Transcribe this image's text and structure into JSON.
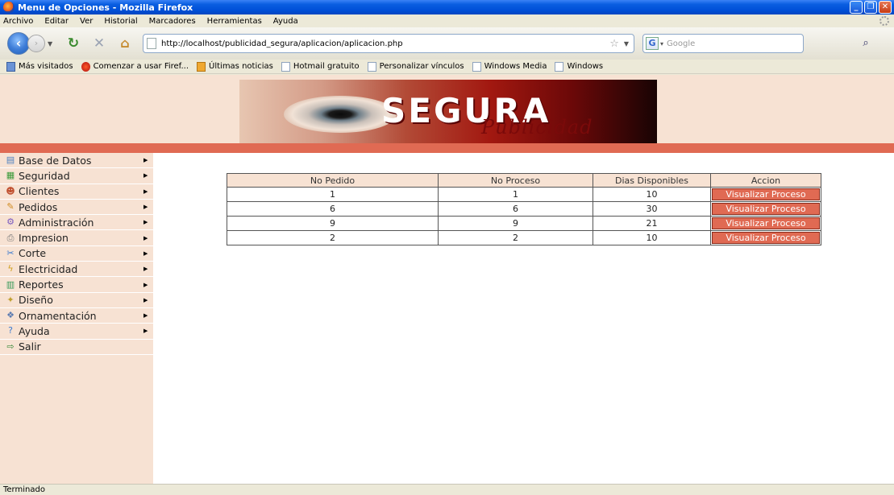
{
  "window": {
    "title": "Menu de Opciones - Mozilla Firefox"
  },
  "menubar": [
    "Archivo",
    "Editar",
    "Ver",
    "Historial",
    "Marcadores",
    "Herramientas",
    "Ayuda"
  ],
  "navigation": {
    "url": "http://localhost/publicidad_segura/aplicacion/aplicacion.php",
    "search_placeholder": "Google"
  },
  "bookmarks": [
    {
      "label": "Más visitados",
      "icon": "visit"
    },
    {
      "label": "Comenzar a usar Firef...",
      "icon": "fox"
    },
    {
      "label": "Últimas noticias",
      "icon": "rss"
    },
    {
      "label": "Hotmail gratuito",
      "icon": "page"
    },
    {
      "label": "Personalizar vínculos",
      "icon": "page"
    },
    {
      "label": "Windows Media",
      "icon": "page"
    },
    {
      "label": "Windows",
      "icon": "page"
    }
  ],
  "banner": {
    "brand": "SEGURA",
    "brand_sub": "Publicidad"
  },
  "sidebar": {
    "items": [
      {
        "label": "Base de Datos",
        "icon": "database-icon",
        "submenu": true
      },
      {
        "label": "Seguridad",
        "icon": "security-icon",
        "submenu": true
      },
      {
        "label": "Clientes",
        "icon": "clients-icon",
        "submenu": true
      },
      {
        "label": "Pedidos",
        "icon": "orders-icon",
        "submenu": true
      },
      {
        "label": "Administración",
        "icon": "admin-icon",
        "submenu": true
      },
      {
        "label": "Impresion",
        "icon": "print-icon",
        "submenu": true
      },
      {
        "label": "Corte",
        "icon": "cut-icon",
        "submenu": true
      },
      {
        "label": "Electricidad",
        "icon": "electricity-icon",
        "submenu": true
      },
      {
        "label": "Reportes",
        "icon": "reports-icon",
        "submenu": true
      },
      {
        "label": "Diseño",
        "icon": "design-icon",
        "submenu": true
      },
      {
        "label": "Ornamentación",
        "icon": "ornament-icon",
        "submenu": true
      },
      {
        "label": "Ayuda",
        "icon": "help-icon",
        "submenu": true
      },
      {
        "label": "Salir",
        "icon": "exit-icon",
        "submenu": false
      }
    ]
  },
  "table": {
    "headers": [
      "No Pedido",
      "No Proceso",
      "Dias Disponibles",
      "Accion"
    ],
    "rows": [
      {
        "pedido": "1",
        "proceso": "1",
        "dias": "10",
        "accion": "Visualizar Proceso"
      },
      {
        "pedido": "6",
        "proceso": "6",
        "dias": "30",
        "accion": "Visualizar Proceso"
      },
      {
        "pedido": "9",
        "proceso": "9",
        "dias": "21",
        "accion": "Visualizar Proceso"
      },
      {
        "pedido": "2",
        "proceso": "2",
        "dias": "10",
        "accion": "Visualizar Proceso"
      }
    ]
  },
  "status": {
    "text": "Terminado"
  },
  "colors": {
    "accent": "#e06a53",
    "background": "#f7e2d3",
    "titlebar": "#0050d8"
  }
}
